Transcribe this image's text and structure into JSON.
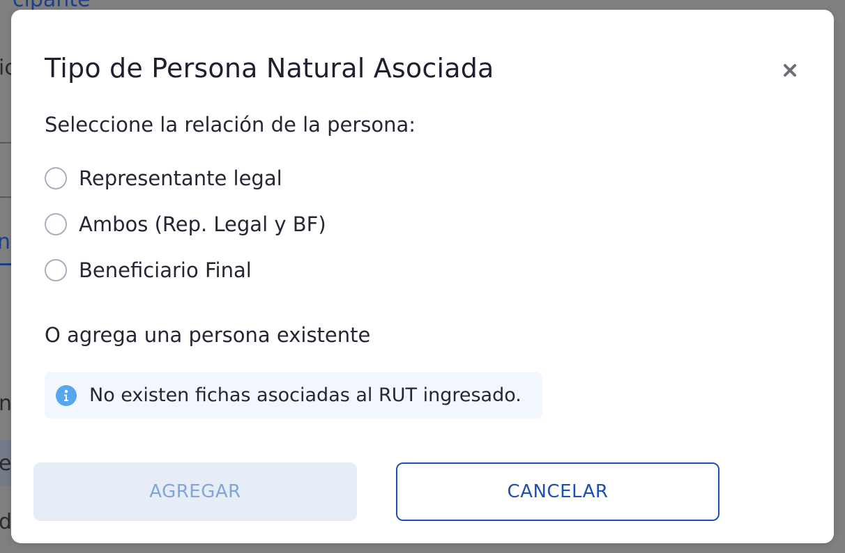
{
  "background": {
    "fragments": [
      "cipante",
      "ic",
      "na",
      "n",
      "e",
      "de"
    ]
  },
  "modal": {
    "title": "Tipo de Persona Natural Asociada",
    "close_icon": "close-icon",
    "prompt": "Seleccione la relación de la persona:",
    "options": [
      {
        "label": "Representante legal",
        "selected": false
      },
      {
        "label": "Ambos (Rep. Legal y BF)",
        "selected": false
      },
      {
        "label": "Beneficiario Final",
        "selected": false
      }
    ],
    "existing_label": "O agrega una persona existente",
    "info": {
      "icon": "info-icon",
      "text": "No existen fichas asociadas al RUT ingresado."
    },
    "buttons": {
      "add_label": "AGREGAR",
      "add_disabled": true,
      "cancel_label": "CANCELAR"
    }
  },
  "colors": {
    "accent": "#1d4fb8",
    "disabled_button_bg": "#e7edf7",
    "disabled_button_text": "#82a4d7",
    "info_bg": "#f1f7fd",
    "info_icon": "#57a7ee",
    "overlay": "#808080"
  }
}
